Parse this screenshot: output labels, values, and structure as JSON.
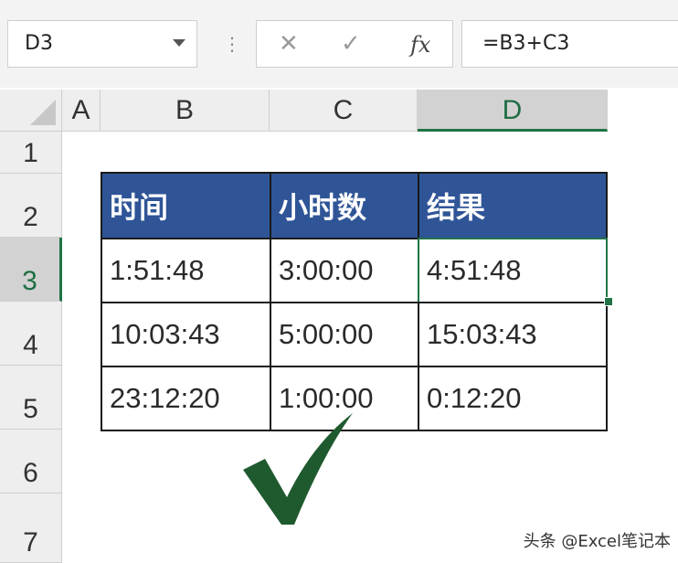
{
  "formula_bar": {
    "name_box": "D3",
    "cancel_icon": "close-icon",
    "enter_icon": "checkmark-icon",
    "function_label": "fx",
    "formula": "=B3+C3"
  },
  "columns": [
    "A",
    "B",
    "C",
    "D"
  ],
  "rows": [
    "1",
    "2",
    "3",
    "4",
    "5",
    "6",
    "7"
  ],
  "selected_cell": "D3",
  "table": {
    "headers": [
      "时间",
      "小时数",
      "结果"
    ],
    "rows": [
      [
        "1:51:48",
        "3:00:00",
        "4:51:48"
      ],
      [
        "10:03:43",
        "5:00:00",
        "15:03:43"
      ],
      [
        "23:12:20",
        "1:00:00",
        "0:12:20"
      ]
    ]
  },
  "colors": {
    "header_fill": "#2f5597",
    "selection": "#217346",
    "checkmark": "#1f5a2e"
  },
  "decoration": {
    "checkmark": "checkmark-icon"
  },
  "watermark": "头条 @Excel笔记本"
}
